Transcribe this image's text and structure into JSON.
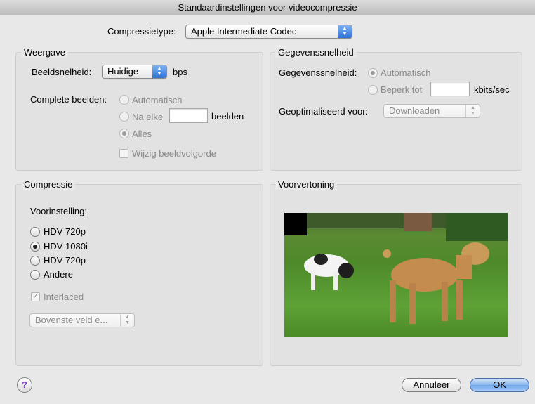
{
  "window": {
    "title": "Standaardinstellingen voor videocompressie"
  },
  "compression_type": {
    "label": "Compressietype:",
    "value": "Apple Intermediate Codec"
  },
  "display": {
    "title": "Weergave",
    "frame_rate_label": "Beeldsnelheid:",
    "frame_rate_value": "Huidige",
    "frame_rate_unit": "bps",
    "keyframes_label": "Complete beelden:",
    "opt_automatic": "Automatisch",
    "opt_every_prefix": "Na elke",
    "opt_every_suffix": "beelden",
    "every_value": "",
    "opt_all": "Alles",
    "reorder_label": "Wijzig beeldvolgorde"
  },
  "datarate": {
    "title": "Gegevenssnelheid",
    "label": "Gegevenssnelheid:",
    "opt_automatic": "Automatisch",
    "opt_limit": "Beperk tot",
    "limit_value": "",
    "unit": "kbits/sec",
    "optimized_label": "Geoptimaliseerd voor:",
    "optimized_value": "Downloaden"
  },
  "compression": {
    "title": "Compressie",
    "preset_label": "Voorinstelling:",
    "presets": [
      "HDV 720p",
      "HDV 1080i",
      "HDV 720p",
      "Andere"
    ],
    "selected_index": 1,
    "interlaced_label": "Interlaced",
    "field_order_value": "Bovenste veld e..."
  },
  "preview": {
    "title": "Voorvertoning"
  },
  "buttons": {
    "cancel": "Annuleer",
    "ok": "OK",
    "help": "?"
  }
}
